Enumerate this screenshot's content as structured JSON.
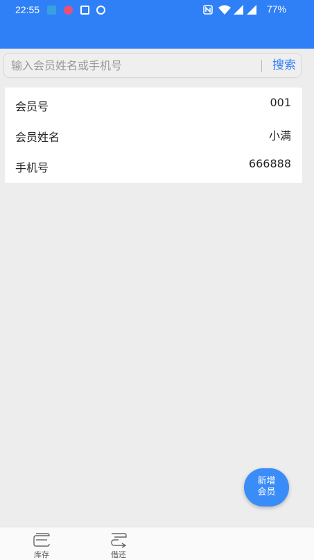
{
  "status_bar": {
    "time": "22:55",
    "battery": "77%"
  },
  "search": {
    "placeholder": "输入会员姓名或手机号",
    "button_label": "搜索"
  },
  "member": {
    "rows": [
      {
        "label": "会员号",
        "value": "001"
      },
      {
        "label": "会员姓名",
        "value": "小满"
      },
      {
        "label": "手机号",
        "value": "666888"
      }
    ]
  },
  "fab": {
    "line1": "新增",
    "line2": "会员"
  },
  "tabs": [
    {
      "label": "库存",
      "icon": "inventory-icon"
    },
    {
      "label": "借还",
      "icon": "borrow-return-icon"
    }
  ],
  "colors": {
    "primary": "#2f80f6",
    "background": "#ededed"
  }
}
